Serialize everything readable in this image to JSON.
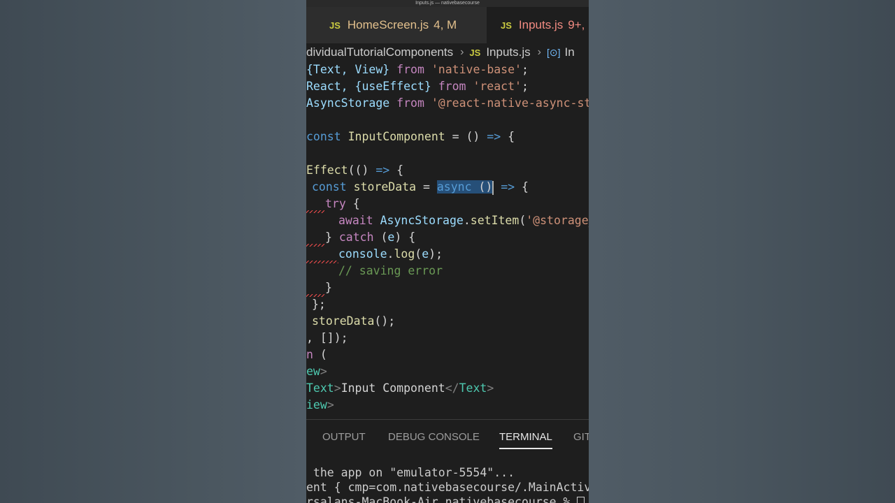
{
  "window": {
    "title": "Inputs.js — nativebasecourse"
  },
  "tabs": [
    {
      "icon": "JS",
      "name": "HomeScreen.js",
      "status": "4, M"
    },
    {
      "icon": "JS",
      "name": "Inputs.js",
      "status": "9+,"
    }
  ],
  "breadcrumb": {
    "folder": "dividualTutorialComponents",
    "file_icon": "JS",
    "file": "Inputs.js",
    "symbol": "In"
  },
  "code": {
    "l1_a": "{Text, View}",
    "l1_b": "from",
    "l1_c": "'native-base'",
    "l1_d": ";",
    "l2_a": "React, {useEffect}",
    "l2_b": "from",
    "l2_c": "'react'",
    "l2_d": ";",
    "l3_a": "AsyncStorage",
    "l3_b": "from",
    "l3_c": "'@react-native-async-sto",
    "l5_a": "const",
    "l5_b": "InputComponent",
    "l5_c": " = () ",
    "l5_d": "=>",
    "l5_e": " {",
    "l7_a": "Effect",
    "l7_b": "(() ",
    "l7_c": "=>",
    "l7_d": " {",
    "l8_a": "const",
    "l8_b": "storeData",
    "l8_c": " = ",
    "l8_d": "async",
    "l8_e": " ()",
    "l8_f": " =>",
    "l8_g": " {",
    "l9_a": "try",
    "l9_b": " {",
    "l10_a": "await",
    "l10_b": "AsyncStorage",
    "l10_c": ".",
    "l10_d": "setItem",
    "l10_e": "(",
    "l10_f": "'@storage_",
    "l11_a": "} ",
    "l11_b": "catch",
    "l11_c": " (",
    "l11_d": "e",
    "l11_e": ") {",
    "l12_a": "console",
    "l12_b": ".",
    "l12_c": "log",
    "l12_d": "(",
    "l12_e": "e",
    "l12_f": ");",
    "l13_a": "// saving error",
    "l14_a": "}",
    "l15_a": "};",
    "l16_a": "storeData",
    "l16_b": "();",
    "l17_a": ", []);",
    "l18_a": "n",
    "l18_b": " (",
    "l19_a": "ew",
    "l19_b": ">",
    "l20_a": "Text",
    "l20_b": ">",
    "l20_c": "Input Component",
    "l20_d": "</",
    "l20_e": "Text",
    "l20_f": ">",
    "l21_a": "iew",
    "l21_b": ">"
  },
  "panel": {
    "tabs": [
      "OUTPUT",
      "DEBUG CONSOLE",
      "TERMINAL",
      "GIT"
    ],
    "active": "TERMINAL"
  },
  "terminal": {
    "line1": " the app on \"emulator-5554\"...",
    "line2": "ent { cmp=com.nativebasecourse/.MainActivit",
    "line3": "rsalans-MacBook-Air nativebasecourse % "
  },
  "colors": {
    "editor_bg": "#1e1e1e",
    "keyword": "#569cd6",
    "control": "#c586c0",
    "string": "#ce9178",
    "function": "#dcdcaa",
    "variable": "#9cdcfe",
    "class": "#4ec9b0",
    "comment": "#6a9955",
    "error": "#f14c4c"
  }
}
